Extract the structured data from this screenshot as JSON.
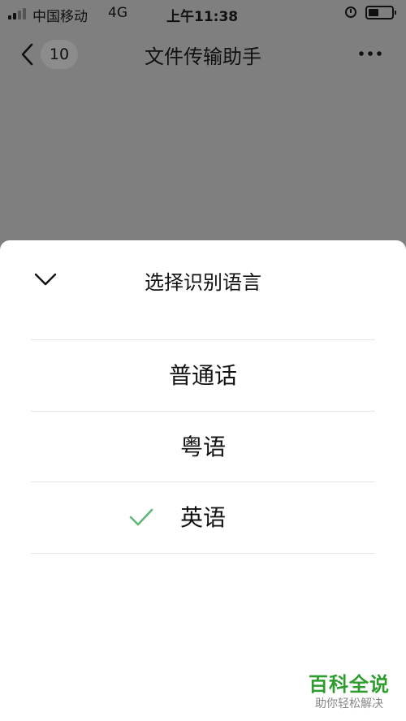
{
  "status_bar": {
    "carrier": "中国移动",
    "network": "4G",
    "time": "上午11:38",
    "battery_level": 0.45
  },
  "nav": {
    "unread_count": "10",
    "title": "文件传输助手"
  },
  "sheet": {
    "title": "选择识别语言",
    "options": [
      {
        "label": "普通话",
        "selected": false
      },
      {
        "label": "粤语",
        "selected": false
      },
      {
        "label": "英语",
        "selected": true
      }
    ]
  },
  "watermark": {
    "title": "百科全说",
    "subtitle": "助你轻松解决"
  },
  "colors": {
    "overlay": "#7f7f7f",
    "sheet_bg": "#ffffff",
    "check": "#5fb878",
    "watermark": "#2e9c2e"
  },
  "icons": [
    "signal-icon",
    "alarm-icon",
    "battery-icon",
    "back-icon",
    "more-icon",
    "chevron-down-icon",
    "check-icon"
  ]
}
